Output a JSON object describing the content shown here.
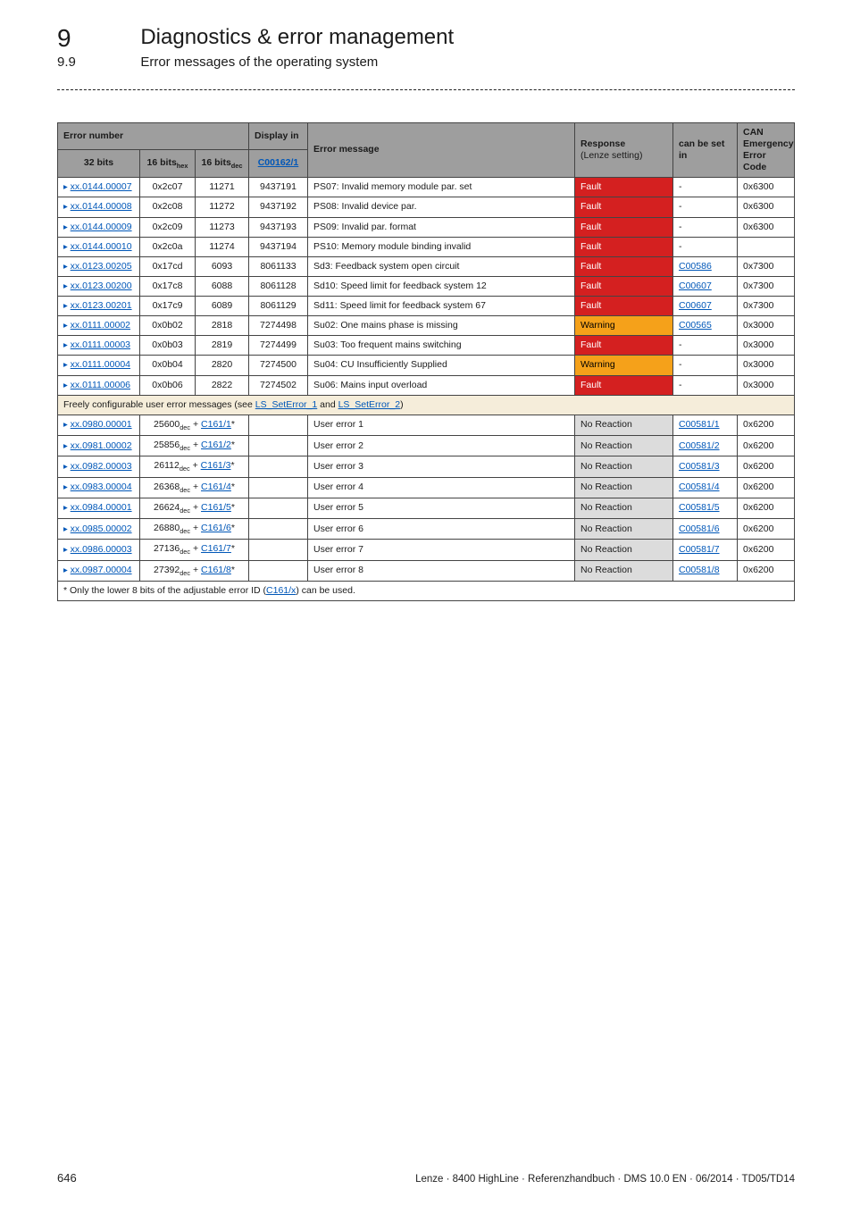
{
  "chapter": {
    "num": "9",
    "title": "Diagnostics & error management"
  },
  "section": {
    "num": "9.9",
    "title": "Error messages of the operating system"
  },
  "table": {
    "headers": {
      "error_number": "Error number",
      "bits32": "32 bits",
      "bitsHex": "16 bits",
      "bitsHexSub": "hex",
      "bitsDec": "16 bits",
      "bitsDecSub": "dec",
      "display_in": "Display in",
      "display_code": "C00162/1",
      "error_message": "Error message",
      "response": "Response",
      "response_sub": "(Lenze setting)",
      "can_be_set_in": "can be set in",
      "can": "CAN",
      "can_sub": "Emergency Error Code"
    },
    "rows": [
      {
        "id": "xx.0144.00007",
        "hex": "0x2c07",
        "dec": "11271",
        "disp": "9437191",
        "msg": "PS07: Invalid memory module par. set",
        "resp": "Fault",
        "resp_type": "fault",
        "set": "-",
        "can": "0x6300"
      },
      {
        "id": "xx.0144.00008",
        "hex": "0x2c08",
        "dec": "11272",
        "disp": "9437192",
        "msg": "PS08: Invalid device par.",
        "resp": "Fault",
        "resp_type": "fault",
        "set": "-",
        "can": "0x6300"
      },
      {
        "id": "xx.0144.00009",
        "hex": "0x2c09",
        "dec": "11273",
        "disp": "9437193",
        "msg": "PS09: Invalid par. format",
        "resp": "Fault",
        "resp_type": "fault",
        "set": "-",
        "can": "0x6300"
      },
      {
        "id": "xx.0144.00010",
        "hex": "0x2c0a",
        "dec": "11274",
        "disp": "9437194",
        "msg": "PS10: Memory module binding invalid",
        "resp": "Fault",
        "resp_type": "fault",
        "set": "-",
        "can": ""
      },
      {
        "id": "xx.0123.00205",
        "hex": "0x17cd",
        "dec": "6093",
        "disp": "8061133",
        "msg": "Sd3: Feedback system open circuit",
        "resp": "Fault",
        "resp_type": "fault",
        "set": "C00586",
        "set_link": true,
        "can": "0x7300"
      },
      {
        "id": "xx.0123.00200",
        "hex": "0x17c8",
        "dec": "6088",
        "disp": "8061128",
        "msg": "Sd10: Speed limit for feedback system 12",
        "resp": "Fault",
        "resp_type": "fault",
        "set": "C00607",
        "set_link": true,
        "can": "0x7300"
      },
      {
        "id": "xx.0123.00201",
        "hex": "0x17c9",
        "dec": "6089",
        "disp": "8061129",
        "msg": "Sd11: Speed limit for feedback system 67",
        "resp": "Fault",
        "resp_type": "fault",
        "set": "C00607",
        "set_link": true,
        "can": "0x7300"
      },
      {
        "id": "xx.0111.00002",
        "hex": "0x0b02",
        "dec": "2818",
        "disp": "7274498",
        "msg": "Su02: One mains phase is missing",
        "resp": "Warning",
        "resp_type": "warn",
        "set": "C00565",
        "set_link": true,
        "can": "0x3000"
      },
      {
        "id": "xx.0111.00003",
        "hex": "0x0b03",
        "dec": "2819",
        "disp": "7274499",
        "msg": "Su03: Too frequent mains switching",
        "resp": "Fault",
        "resp_type": "fault",
        "set": "-",
        "can": "0x3000"
      },
      {
        "id": "xx.0111.00004",
        "hex": "0x0b04",
        "dec": "2820",
        "disp": "7274500",
        "msg": "Su04: CU Insufficiently Supplied",
        "resp": "Warning",
        "resp_type": "warn",
        "set": "-",
        "can": "0x3000"
      },
      {
        "id": "xx.0111.00006",
        "hex": "0x0b06",
        "dec": "2822",
        "disp": "7274502",
        "msg": "Su06: Mains input overload",
        "resp": "Fault",
        "resp_type": "fault",
        "set": "-",
        "can": "0x3000"
      }
    ],
    "span_row": {
      "prefix": "Freely configurable user error messages (see ",
      "l1": "LS_SetError_1",
      "mid": " and ",
      "l2": "LS_SetError_2",
      "suffix": ")"
    },
    "user_rows": [
      {
        "id": "xx.0980.00001",
        "hex_prefix": "25600",
        "cref": "C161/1",
        "msg": "User error 1",
        "resp": "No Reaction",
        "set": "C00581/1",
        "can": "0x6200"
      },
      {
        "id": "xx.0981.00002",
        "hex_prefix": "25856",
        "cref": "C161/2",
        "msg": "User error 2",
        "resp": "No Reaction",
        "set": "C00581/2",
        "can": "0x6200"
      },
      {
        "id": "xx.0982.00003",
        "hex_prefix": "26112",
        "cref": "C161/3",
        "msg": "User error 3",
        "resp": "No Reaction",
        "set": "C00581/3",
        "can": "0x6200"
      },
      {
        "id": "xx.0983.00004",
        "hex_prefix": "26368",
        "cref": "C161/4",
        "msg": "User error 4",
        "resp": "No Reaction",
        "set": "C00581/4",
        "can": "0x6200"
      },
      {
        "id": "xx.0984.00001",
        "hex_prefix": "26624",
        "cref": "C161/5",
        "msg": "User error 5",
        "resp": "No Reaction",
        "set": "C00581/5",
        "can": "0x6200"
      },
      {
        "id": "xx.0985.00002",
        "hex_prefix": "26880",
        "cref": "C161/6",
        "msg": "User error 6",
        "resp": "No Reaction",
        "set": "C00581/6",
        "can": "0x6200"
      },
      {
        "id": "xx.0986.00003",
        "hex_prefix": "27136",
        "cref": "C161/7",
        "msg": "User error 7",
        "resp": "No Reaction",
        "set": "C00581/7",
        "can": "0x6200"
      },
      {
        "id": "xx.0987.00004",
        "hex_prefix": "27392",
        "cref": "C161/8",
        "msg": "User error 8",
        "resp": "No Reaction",
        "set": "C00581/8",
        "can": "0x6200"
      }
    ],
    "footnote": {
      "prefix": "* Only the lower 8 bits of the adjustable error ID (",
      "link": "C161/x",
      "suffix": ") can be used."
    }
  },
  "hex_sub": "dec",
  "footer": {
    "page": "646",
    "info": "Lenze · 8400 HighLine · Referenzhandbuch · DMS 10.0 EN · 06/2014 · TD05/TD14"
  }
}
